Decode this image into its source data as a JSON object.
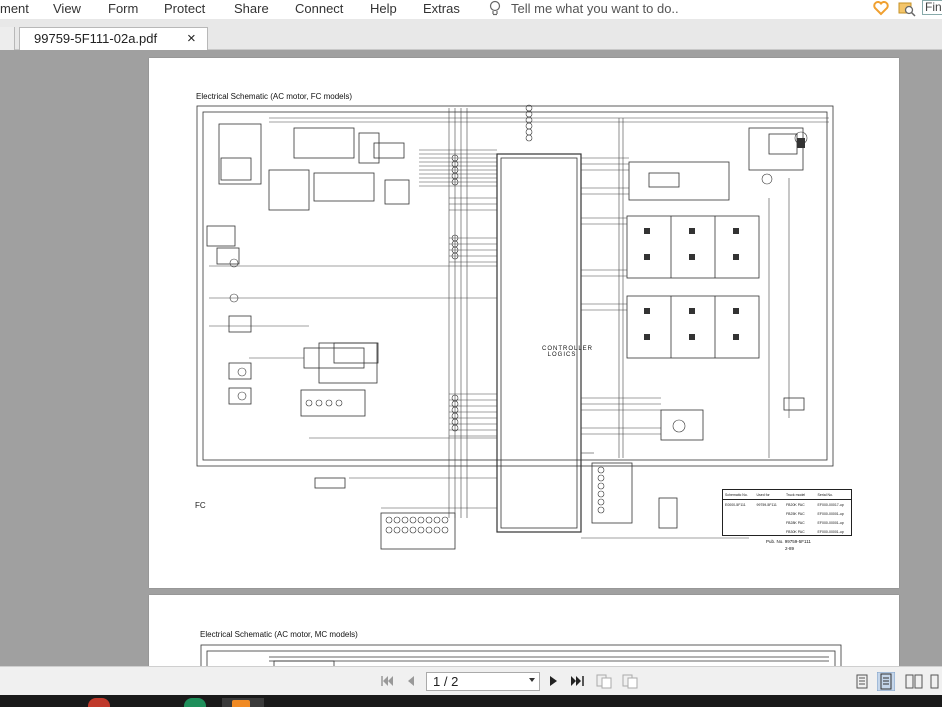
{
  "menubar": {
    "items": [
      "ment",
      "View",
      "Form",
      "Protect",
      "Share",
      "Connect",
      "Help",
      "Extras"
    ],
    "tell_me_placeholder": "Tell me what you want to do..",
    "find_text": "Fin"
  },
  "tabs": {
    "active_doc": "99759-5F111-02a.pdf",
    "close_glyph": "×"
  },
  "document": {
    "page1": {
      "title": "Electrical Schematic (AC motor, FC models)",
      "corner_label": "FC",
      "pub_no": "Pub. No. 99759-5F111",
      "page_number": "2-89",
      "controller_label": "CONTROLLER LOGICS",
      "table_headers": [
        "Schematic No.",
        "Used for",
        "Truck model",
        "Serial No."
      ],
      "table_rows": [
        [
          "E0000-5F111",
          "99759-5F111",
          "FB20K PAC",
          "EF000-00017-up"
        ],
        [
          "",
          "",
          "FB25K PAC",
          "EF000-00001-up"
        ],
        [
          "",
          "",
          "FB28K PAC",
          "EF000-00001-up"
        ],
        [
          "",
          "",
          "FB30K PAC",
          "EF000-00001-up"
        ]
      ]
    },
    "page2": {
      "title": "Electrical Schematic (AC motor, MC models)"
    }
  },
  "bottombar": {
    "page_indicator": "1 / 2"
  },
  "colors": {
    "menubar_bg": "#ffffff",
    "viewport_bg": "#a0a0a0",
    "fav_icon": "#f0a030"
  }
}
